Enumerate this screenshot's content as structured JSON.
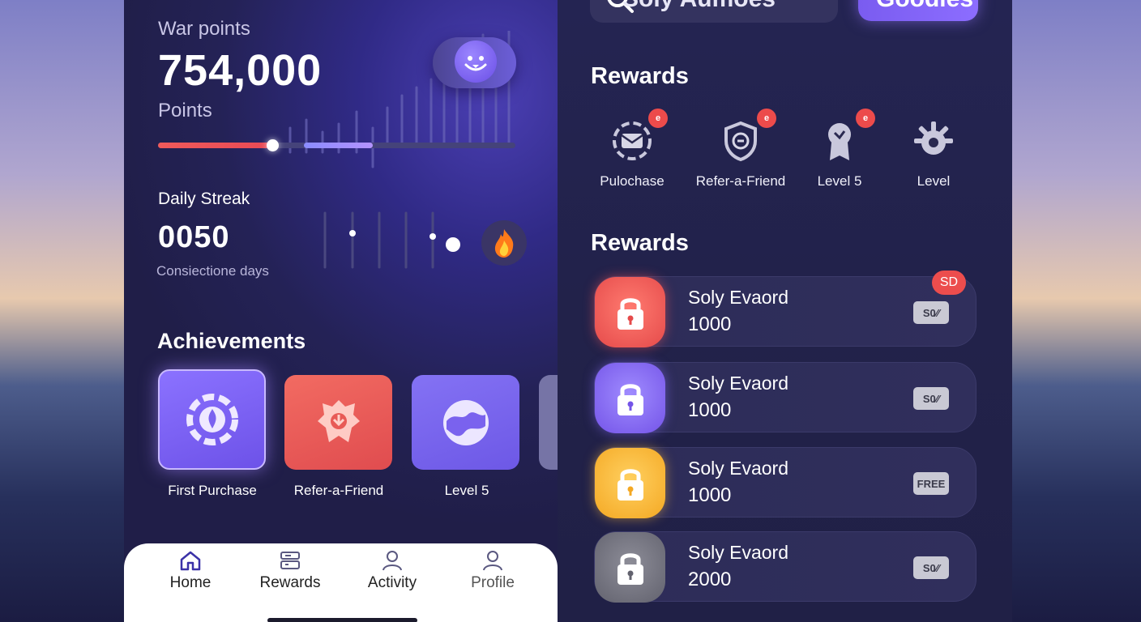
{
  "war_points": {
    "label": "War points",
    "value": "754,000",
    "unit": "Points",
    "progress_fraction": 0.32
  },
  "daily_streak": {
    "label": "Daily Streak",
    "value": "0050",
    "unit": "Consiectione days"
  },
  "achievements": {
    "title": "Achievements",
    "items": [
      {
        "label": "First Purchase",
        "icon": "first-purchase-icon"
      },
      {
        "label": "Refer-a-Friend",
        "icon": "refer-friend-icon"
      },
      {
        "label": "Level 5",
        "icon": "level-icon"
      }
    ]
  },
  "tabbar": {
    "items": [
      {
        "label": "Home",
        "icon": "home-icon"
      },
      {
        "label": "Rewards",
        "icon": "rewards-icon"
      },
      {
        "label": "Activity",
        "icon": "activity-icon"
      },
      {
        "label": "Profile",
        "icon": "profile-icon"
      }
    ]
  },
  "search": {
    "value": "Soly Aumoes",
    "button_label": "Goodies"
  },
  "rewards_section": {
    "title": "Rewards",
    "categories": [
      {
        "label": "Pulochase",
        "badge": "e",
        "icon": "mail-icon"
      },
      {
        "label": "Refer-a-Friend",
        "badge": "e",
        "icon": "shield-icon"
      },
      {
        "label": "Level 5",
        "badge": "e",
        "icon": "ribbon-icon"
      },
      {
        "label": "Level",
        "icon": "gear-icon"
      }
    ]
  },
  "rewards_list": {
    "title": "Rewards",
    "badge": "SD",
    "items": [
      {
        "name": "Soly Evaord",
        "points": "1000",
        "tag": "S0⁄⁄",
        "color": "#e54a4a"
      },
      {
        "name": "Soly Evaord",
        "points": "1000",
        "tag": "S0⁄⁄",
        "color": "#7454e8"
      },
      {
        "name": "Soly Evaord",
        "points": "1000",
        "tag": "FREE",
        "color": "#f4a823"
      },
      {
        "name": "Soly Evaord",
        "points": "2000",
        "tag": "S0⁄⁄",
        "color": "#62626e"
      }
    ]
  }
}
